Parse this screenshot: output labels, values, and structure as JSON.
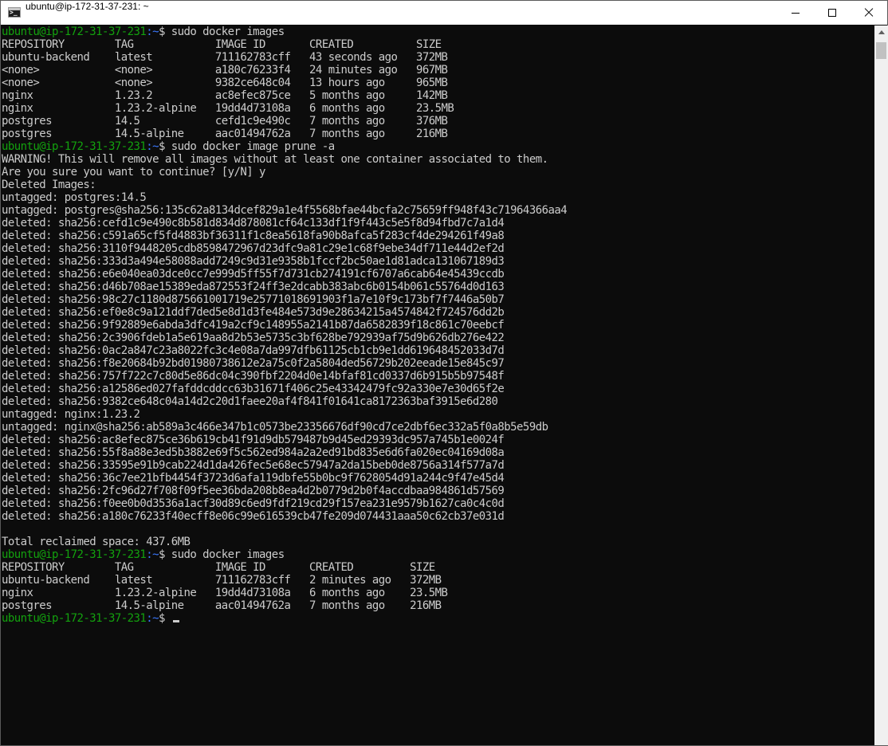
{
  "window": {
    "title": "ubuntu@ip-172-31-37-231: ~",
    "icon": "terminal-icon",
    "controls": [
      "minimize",
      "maximize",
      "close"
    ]
  },
  "prompt": {
    "user_host": "ubuntu@ip-172-31-37-231",
    "path": ":~",
    "symbol": "$ "
  },
  "colors": {
    "background": "#0c0c0c",
    "text": "#cccccc",
    "prompt_user": "#13a10e",
    "prompt_path": "#3b78ff"
  },
  "terminal": {
    "lines": [
      {
        "type": "prompt",
        "cmd": "sudo docker images"
      },
      {
        "type": "out",
        "text": "REPOSITORY        TAG             IMAGE ID       CREATED          SIZE"
      },
      {
        "type": "out",
        "text": "ubuntu-backend    latest          711162783cff   43 seconds ago   372MB"
      },
      {
        "type": "out",
        "text": "<none>            <none>          a180c76233f4   24 minutes ago   967MB"
      },
      {
        "type": "out",
        "text": "<none>            <none>          9382ce648c04   13 hours ago     965MB"
      },
      {
        "type": "out",
        "text": "nginx             1.23.2          ac8efec875ce   5 months ago     142MB"
      },
      {
        "type": "out",
        "text": "nginx             1.23.2-alpine   19dd4d73108a   6 months ago     23.5MB"
      },
      {
        "type": "out",
        "text": "postgres          14.5            cefd1c9e490c   7 months ago     376MB"
      },
      {
        "type": "out",
        "text": "postgres          14.5-alpine     aac01494762a   7 months ago     216MB"
      },
      {
        "type": "prompt",
        "cmd": "sudo docker image prune -a"
      },
      {
        "type": "out",
        "text": "WARNING! This will remove all images without at least one container associated to them."
      },
      {
        "type": "out",
        "text": "Are you sure you want to continue? [y/N] y"
      },
      {
        "type": "out",
        "text": "Deleted Images:"
      },
      {
        "type": "out",
        "text": "untagged: postgres:14.5"
      },
      {
        "type": "out",
        "text": "untagged: postgres@sha256:135c62a8134dcef829a1e4f5568bfae44bcfa2c75659ff948f43c71964366aa4"
      },
      {
        "type": "out",
        "text": "deleted: sha256:cefd1c9e490c8b581d834d878081cf64c133df1f9f443c5e5f8d94fbd7c7a1d4"
      },
      {
        "type": "out",
        "text": "deleted: sha256:c591a65cf5fd4883bf36311f1c8ea5618fa90b8afca5f283cf4de294261f49a8"
      },
      {
        "type": "out",
        "text": "deleted: sha256:3110f9448205cdb8598472967d23dfc9a81c29e1c68f9ebe34df711e44d2ef2d"
      },
      {
        "type": "out",
        "text": "deleted: sha256:333d3a494e58088add7249c9d31e9358b1fccf2bc50ae1d81adca131067189d3"
      },
      {
        "type": "out",
        "text": "deleted: sha256:e6e040ea03dce0cc7e999d5ff55f7d731cb274191cf6707a6cab64e45439ccdb"
      },
      {
        "type": "out",
        "text": "deleted: sha256:d46b708ae15389eda872553f24ff3e2dcabb383abc6b0154b061c55764d0d163"
      },
      {
        "type": "out",
        "text": "deleted: sha256:98c27c1180d875661001719e25771018691903f1a7e10f9c173bf7f7446a50b7"
      },
      {
        "type": "out",
        "text": "deleted: sha256:ef0e8c9a121ddf7ded5e8d1d3fe484e573d9e28634215a4574842f724576dd2b"
      },
      {
        "type": "out",
        "text": "deleted: sha256:9f92889e6abda3dfc419a2cf9c148955a2141b87da6582839f18c861c70eebcf"
      },
      {
        "type": "out",
        "text": "deleted: sha256:2c3906fdeb1a5e619aa8d2b53e5735c3bf628be792939af75d9b626db276e422"
      },
      {
        "type": "out",
        "text": "deleted: sha256:0ac2a847c23a8022fc3c4e08a7da997dfb61125cb1cb9e1dd619648452033d7d"
      },
      {
        "type": "out",
        "text": "deleted: sha256:f8e20684b92bd01980738612e2a75c0f2a5804ded56729b202eeade15e845c97"
      },
      {
        "type": "out",
        "text": "deleted: sha256:757f722c7c80d5e86dc04c390fbf2204d0e14bfaf81cd0337d6b915b5b97548f"
      },
      {
        "type": "out",
        "text": "deleted: sha256:a12586ed027fafddcddcc63b31671f406c25e43342479fc92a330e7e30d65f2e"
      },
      {
        "type": "out",
        "text": "deleted: sha256:9382ce648c04a14d2c20d1faee20af4f841f01641ca8172363baf3915e6d280"
      },
      {
        "type": "out",
        "text": "untagged: nginx:1.23.2"
      },
      {
        "type": "out",
        "text": "untagged: nginx@sha256:ab589a3c466e347b1c0573be23356676df90cd7ce2dbf6ec332a5f0a8b5e59db"
      },
      {
        "type": "out",
        "text": "deleted: sha256:ac8efec875ce36b619cb41f91d9db579487b9d45ed29393dc957a745b1e0024f"
      },
      {
        "type": "out",
        "text": "deleted: sha256:55f8a88e3ed5b3882e69f5c562ed984a2a2ed91bd835e6d6fa020ec04169d08a"
      },
      {
        "type": "out",
        "text": "deleted: sha256:33595e91b9cab224d1da426fec5e68ec57947a2da15beb0de8756a314f577a7d"
      },
      {
        "type": "out",
        "text": "deleted: sha256:36c7ee21bfb4454f3723d6afa119dbfe55b0bc9f7628054d91a244c9f47e45d4"
      },
      {
        "type": "out",
        "text": "deleted: sha256:2fc96d27f708f09f5ee36bda208b8ea4d2b0779d2b0f4accdbaa984861d57569"
      },
      {
        "type": "out",
        "text": "deleted: sha256:f0ee0b0d3536a1acf30d89c6ed9fdf219cd29f157ea231e9579b1627ca0c4c0d"
      },
      {
        "type": "out",
        "text": "deleted: sha256:a180c76233f40ecff8e06c99e616539cb47fe209d074431aaa50c62cb37e031d"
      },
      {
        "type": "out",
        "text": ""
      },
      {
        "type": "out",
        "text": "Total reclaimed space: 437.6MB"
      },
      {
        "type": "prompt",
        "cmd": "sudo docker images"
      },
      {
        "type": "out",
        "text": "REPOSITORY        TAG             IMAGE ID       CREATED         SIZE"
      },
      {
        "type": "out",
        "text": "ubuntu-backend    latest          711162783cff   2 minutes ago   372MB"
      },
      {
        "type": "out",
        "text": "nginx             1.23.2-alpine   19dd4d73108a   6 months ago    23.5MB"
      },
      {
        "type": "out",
        "text": "postgres          14.5-alpine     aac01494762a   7 months ago    216MB"
      },
      {
        "type": "prompt",
        "cmd": "",
        "cursor": true
      }
    ]
  }
}
